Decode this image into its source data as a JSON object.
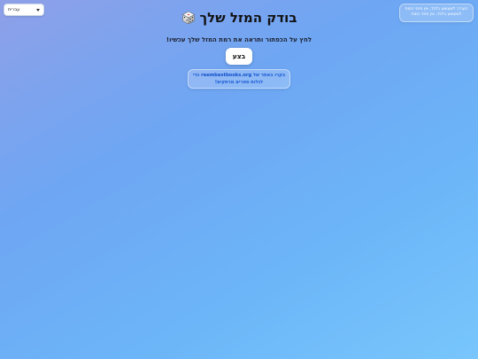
{
  "language_selector": {
    "selected": "עברית"
  },
  "notice": {
    "text": "הערה: לשעשוע בלבד, אין סיכוי כמות לשעשוע בלבד, אין סיכוי כמות"
  },
  "header": {
    "title": "בודק המזל שלך",
    "icon": "dice-icon"
  },
  "subtitle": "לחץ על הכפתור ותראה את רמת המזל שלך עכשיו!",
  "run_button": {
    "label": "בצע"
  },
  "promo": {
    "prefix": "בקרו באתר של ",
    "link": "reembestbooks.org",
    "suffix": " כדי לגלות ספרים מרתקים!"
  },
  "colors": {
    "background_start": "#8ea0e8",
    "background_end": "#78c6fc",
    "link": "#0f4fc9"
  }
}
